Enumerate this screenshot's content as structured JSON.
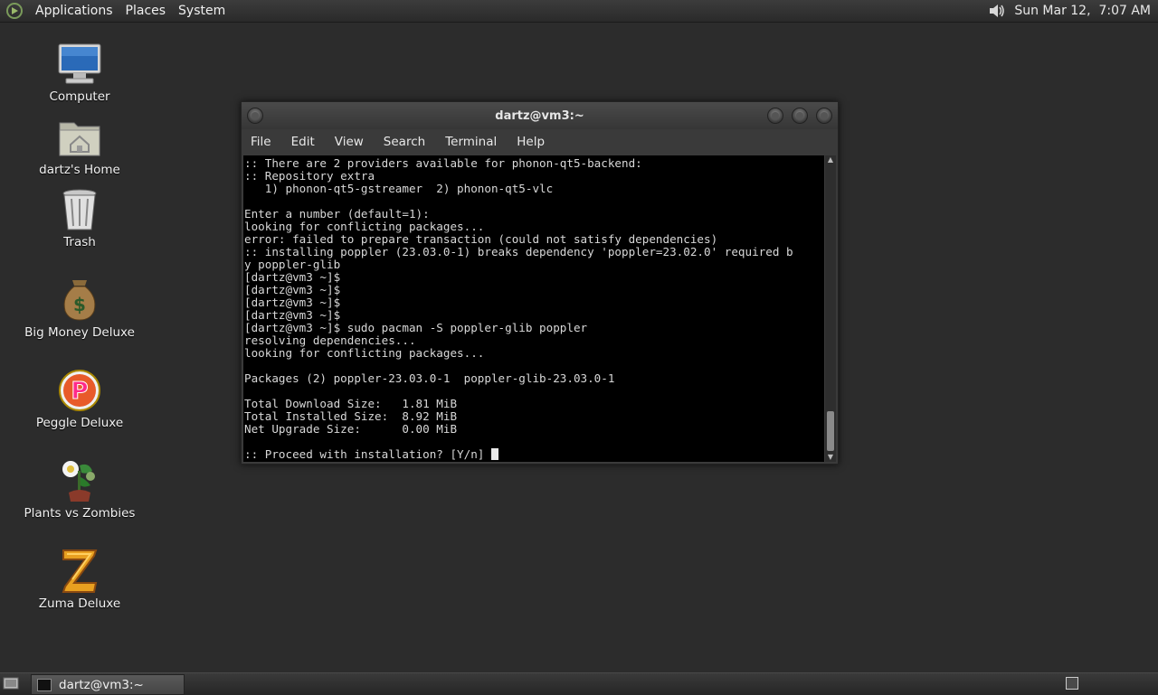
{
  "top_panel": {
    "menus": [
      "Applications",
      "Places",
      "System"
    ],
    "clock": "Sun Mar 12,  7:07 AM",
    "icons": {
      "logo": "gnome-foot-icon",
      "volume": "volume-icon"
    }
  },
  "desktop": {
    "icons": [
      {
        "label": "Computer",
        "icon": "computer-icon"
      },
      {
        "label": "dartz's Home",
        "icon": "home-folder-icon"
      },
      {
        "label": "Trash",
        "icon": "trash-icon"
      },
      {
        "label": "Big Money Deluxe",
        "icon": "money-bag-icon"
      },
      {
        "label": "Peggle Deluxe",
        "icon": "peggle-icon"
      },
      {
        "label": "Plants vs Zombies",
        "icon": "plants-vs-zombies-icon"
      },
      {
        "label": "Zuma Deluxe",
        "icon": "zuma-icon"
      }
    ]
  },
  "terminal": {
    "title": "dartz@vm3:~",
    "menus": [
      "File",
      "Edit",
      "View",
      "Search",
      "Terminal",
      "Help"
    ],
    "lines": [
      ":: There are 2 providers available for phonon-qt5-backend:",
      ":: Repository extra",
      "   1) phonon-qt5-gstreamer  2) phonon-qt5-vlc",
      "",
      "Enter a number (default=1):",
      "looking for conflicting packages...",
      "error: failed to prepare transaction (could not satisfy dependencies)",
      ":: installing poppler (23.03.0-1) breaks dependency 'poppler=23.02.0' required b",
      "y poppler-glib",
      "[dartz@vm3 ~]$",
      "[dartz@vm3 ~]$",
      "[dartz@vm3 ~]$",
      "[dartz@vm3 ~]$",
      "[dartz@vm3 ~]$ sudo pacman -S poppler-glib poppler",
      "resolving dependencies...",
      "looking for conflicting packages...",
      "",
      "Packages (2) poppler-23.03.0-1  poppler-glib-23.03.0-1",
      "",
      "Total Download Size:   1.81 MiB",
      "Total Installed Size:  8.92 MiB",
      "Net Upgrade Size:      0.00 MiB",
      ""
    ],
    "prompt": ":: Proceed with installation? [Y/n] "
  },
  "taskbar": {
    "task_label": "dartz@vm3:~"
  }
}
